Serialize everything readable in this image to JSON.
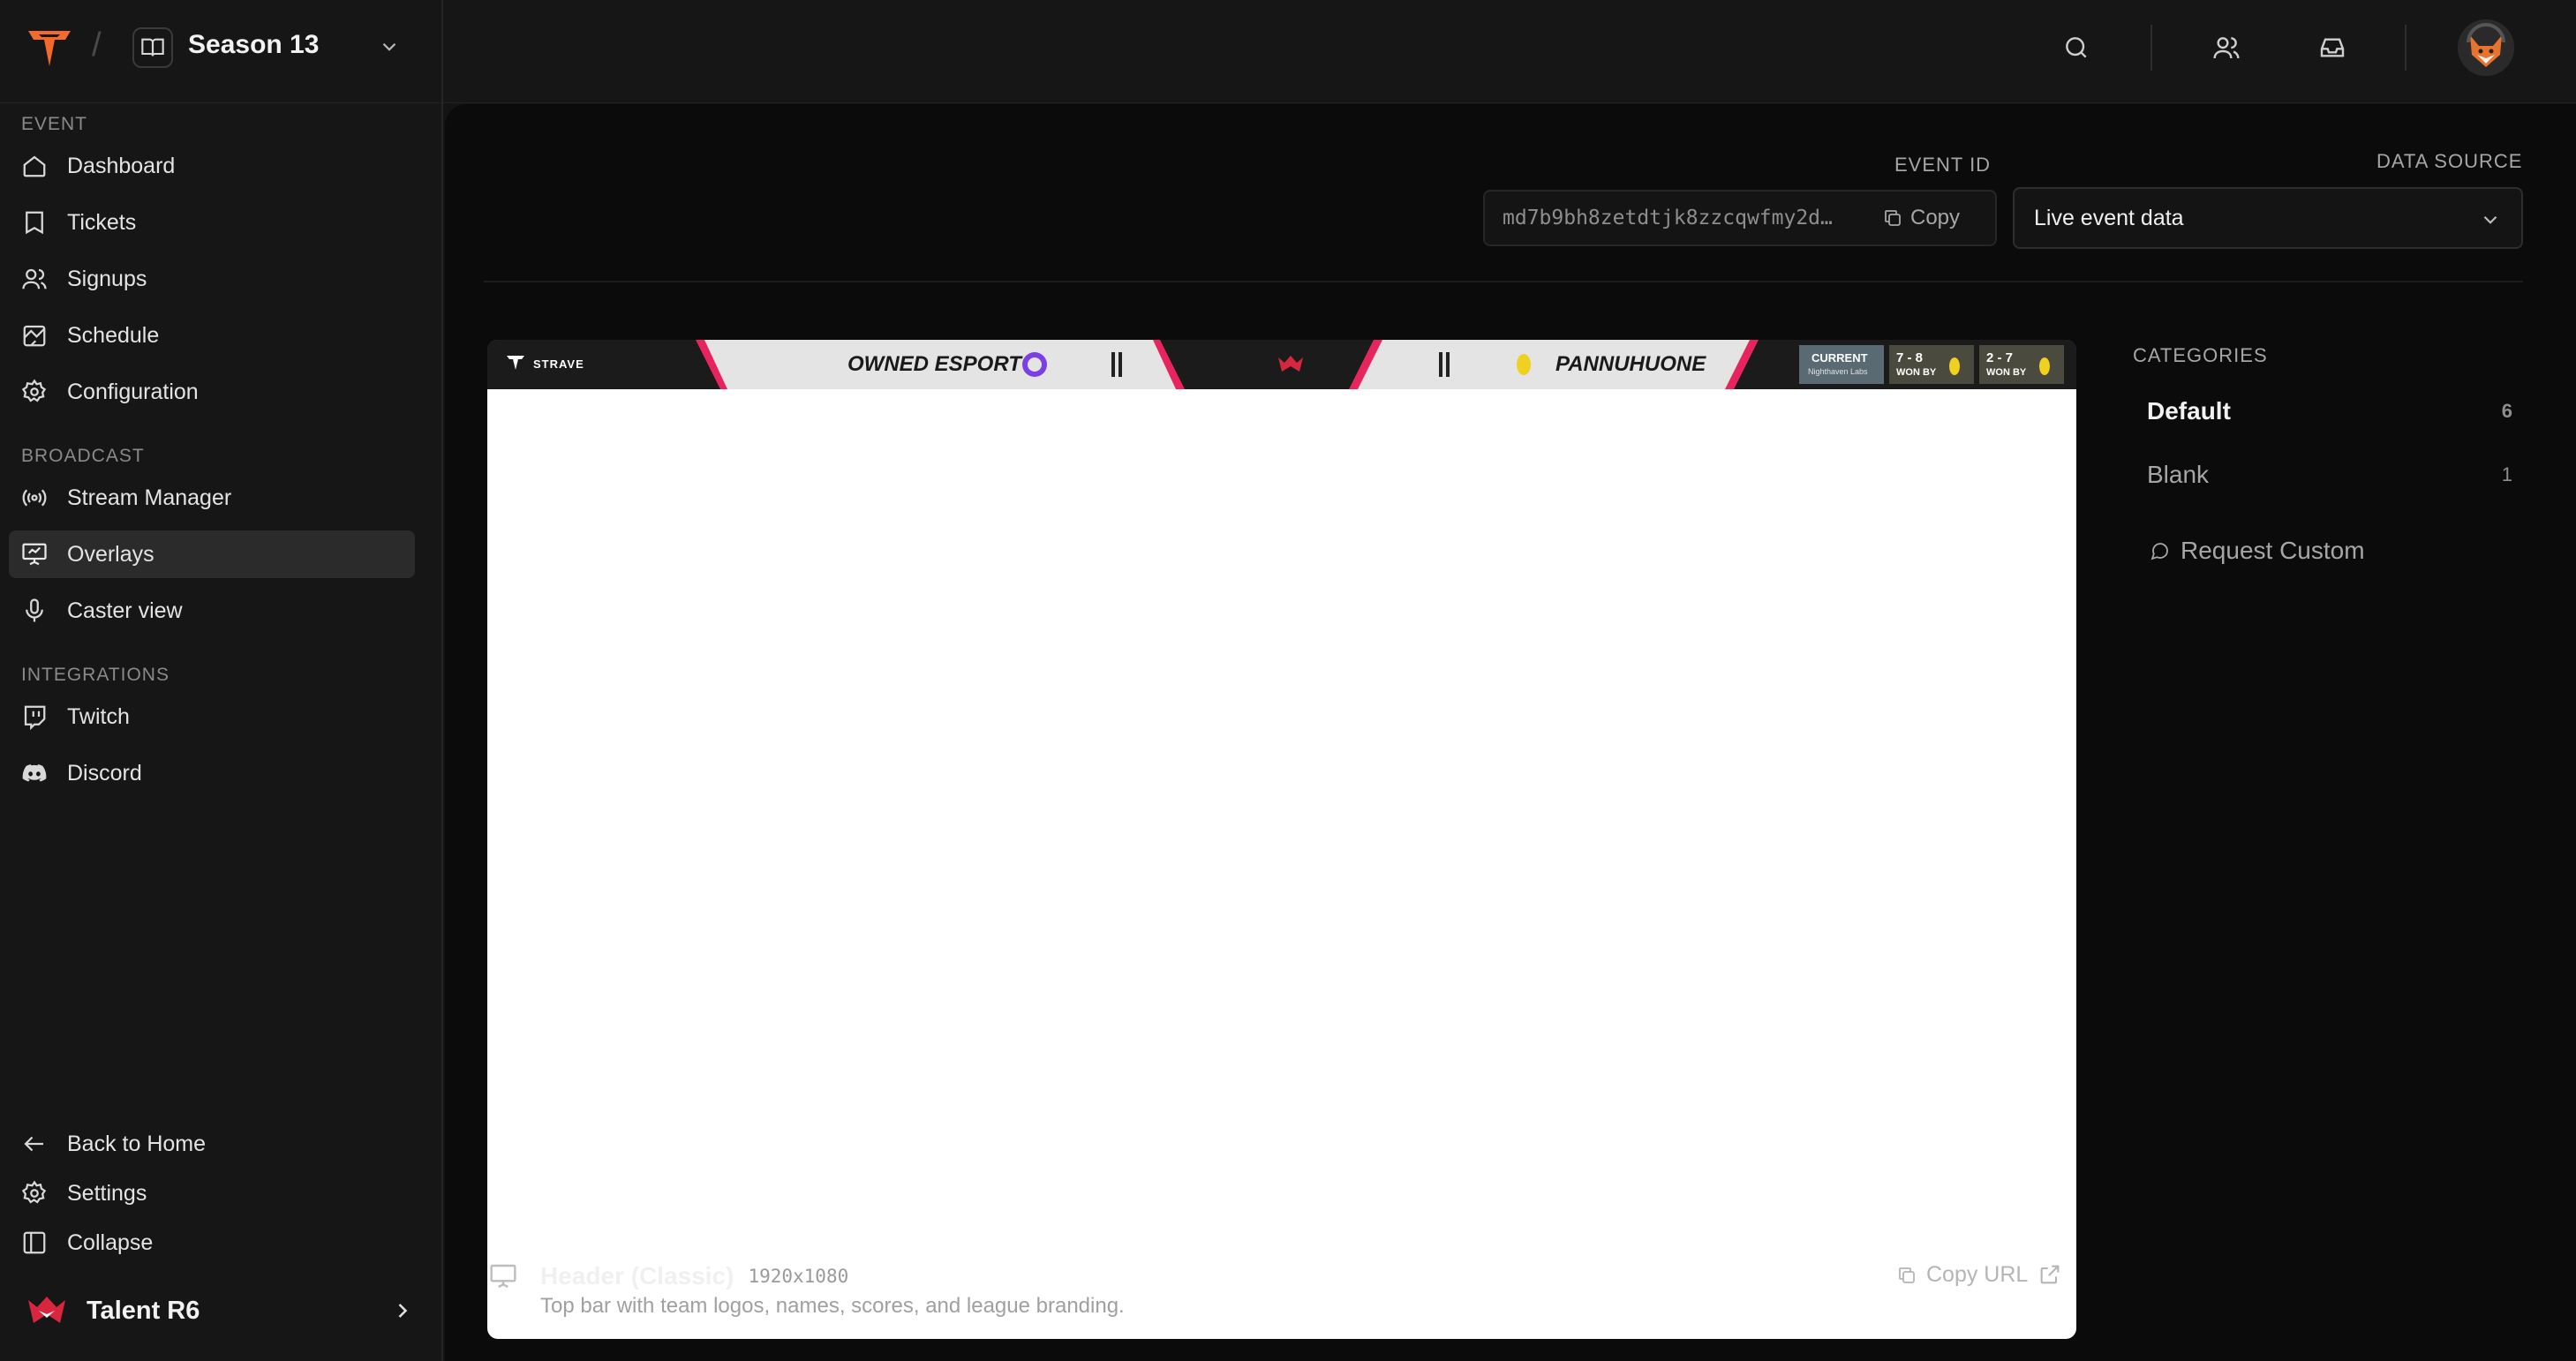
{
  "topbar": {
    "separator": "/",
    "season_title": "Season 13"
  },
  "sidebar": {
    "sections": [
      {
        "label": "EVENT",
        "items": [
          {
            "label": "Dashboard",
            "icon": "home-icon"
          },
          {
            "label": "Tickets",
            "icon": "ticket-icon"
          },
          {
            "label": "Signups",
            "icon": "users-icon"
          },
          {
            "label": "Schedule",
            "icon": "schedule-icon"
          },
          {
            "label": "Configuration",
            "icon": "gear-icon"
          }
        ]
      },
      {
        "label": "BROADCAST",
        "items": [
          {
            "label": "Stream Manager",
            "icon": "broadcast-icon"
          },
          {
            "label": "Overlays",
            "icon": "presentation-icon",
            "active": true
          },
          {
            "label": "Caster view",
            "icon": "microphone-icon"
          }
        ]
      },
      {
        "label": "INTEGRATIONS",
        "items": [
          {
            "label": "Twitch",
            "icon": "twitch-icon"
          },
          {
            "label": "Discord",
            "icon": "discord-icon"
          }
        ]
      }
    ],
    "footer": {
      "back_home": "Back to Home",
      "settings": "Settings",
      "collapse": "Collapse",
      "team_name": "Talent R6"
    }
  },
  "main": {
    "event_id_label": "EVENT ID",
    "event_id_value": "md7b9bh8zetdtjk8zzcqwfmy2d…",
    "copy_label": "Copy",
    "data_source_label": "DATA SOURCE",
    "data_source_value": "Live event data",
    "overlay_preview": {
      "brand": "STRAVE",
      "team_left": "OWNED ESPORT",
      "team_right": "PANNUHUONE",
      "map_slots": [
        {
          "top": "CURRENT",
          "bottom": "Nighthaven Labs"
        },
        {
          "top": "7 - 8",
          "bottom": "WON BY"
        },
        {
          "top": "2 - 7",
          "bottom": "WON BY"
        }
      ]
    },
    "overlay_title": "Header (Classic)",
    "overlay_resolution": "1920x1080",
    "overlay_description": "Top bar with team logos, names, scores, and league branding.",
    "copy_url_label": "Copy URL",
    "categories": {
      "label": "CATEGORIES",
      "items": [
        {
          "name": "Default",
          "count": "6",
          "active": true
        },
        {
          "name": "Blank",
          "count": "1",
          "active": false
        }
      ],
      "request_custom": "Request Custom"
    }
  },
  "colors": {
    "accent_orange": "#f26b2a",
    "accent_pink": "#e8245f",
    "background": "#0b0b0b",
    "sidebar": "#161616"
  }
}
